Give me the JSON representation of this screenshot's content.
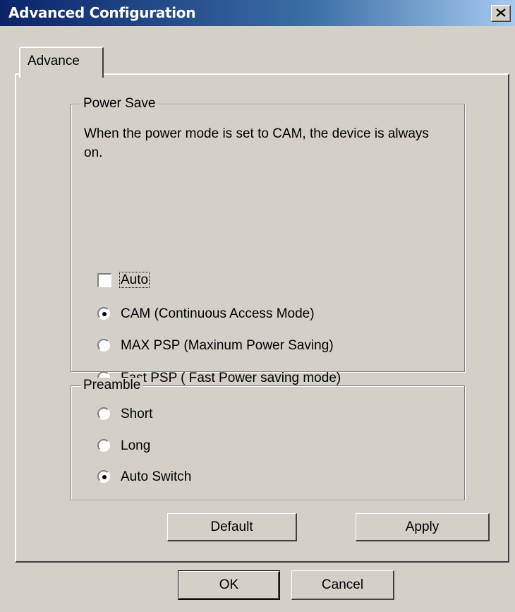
{
  "window": {
    "title": "Advanced Configuration",
    "close_icon": "close-icon"
  },
  "tab": {
    "label": "Advance"
  },
  "power_save": {
    "label": "Power Save",
    "description": "When the power mode is set to CAM, the device is always on.",
    "auto_checkbox": {
      "label": "Auto",
      "checked": false
    },
    "modes": [
      {
        "label": "CAM (Continuous Access Mode)",
        "selected": true
      },
      {
        "label": "MAX PSP (Maxinum Power Saving)",
        "selected": false
      },
      {
        "label": "Fast PSP ( Fast Power saving mode)",
        "selected": false
      }
    ]
  },
  "preamble": {
    "label": "Preamble",
    "options": [
      {
        "label": "Short",
        "selected": false
      },
      {
        "label": "Long",
        "selected": false
      },
      {
        "label": "Auto Switch",
        "selected": true
      }
    ]
  },
  "buttons": {
    "default_label": "Default",
    "apply_label": "Apply",
    "ok_label": "OK",
    "cancel_label": "Cancel"
  },
  "colors": {
    "titlebar_start": "#0a246a",
    "titlebar_end": "#a6caf0",
    "face": "#d4d0c8"
  }
}
